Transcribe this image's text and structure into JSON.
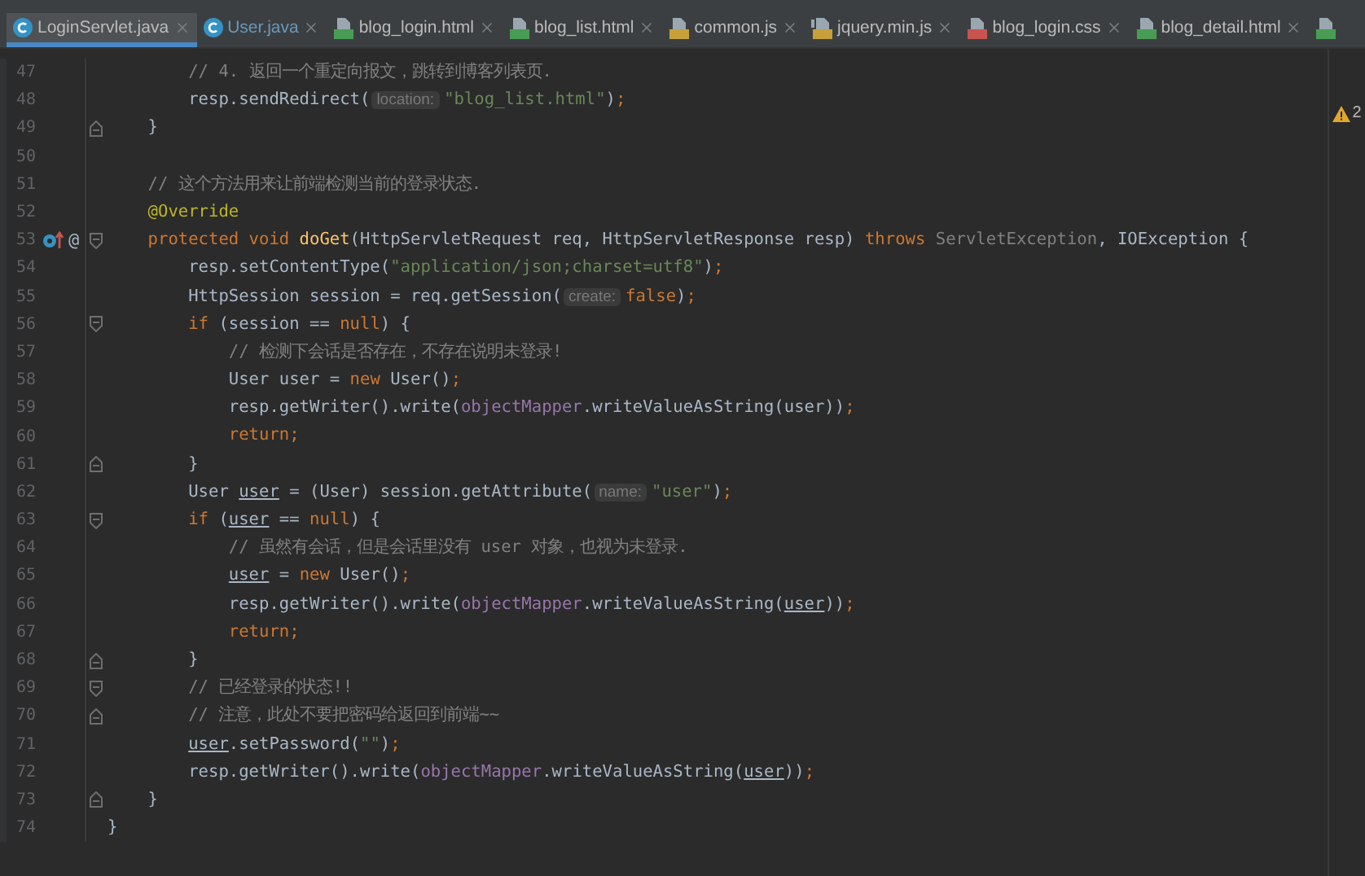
{
  "tabs": [
    {
      "kind": "java",
      "label": "LoginServlet.java",
      "selected": true,
      "modified": false
    },
    {
      "kind": "java",
      "label": "User.java",
      "selected": false,
      "modified": true
    },
    {
      "kind": "html",
      "label": "blog_login.html",
      "selected": false,
      "modified": false
    },
    {
      "kind": "html",
      "label": "blog_list.html",
      "selected": false,
      "modified": false
    },
    {
      "kind": "js",
      "label": "common.js",
      "selected": false,
      "modified": false
    },
    {
      "kind": "binary-js",
      "label": "jquery.min.js",
      "selected": false,
      "modified": false
    },
    {
      "kind": "css",
      "label": "blog_login.css",
      "selected": false,
      "modified": false
    },
    {
      "kind": "html",
      "label": "blog_detail.html",
      "selected": false,
      "modified": false
    },
    {
      "kind": "html",
      "selected": false
    }
  ],
  "inspections": {
    "warnings": "2"
  },
  "lines": [
    {
      "number": "47",
      "tokens": [
        {
          "text": "        // 4. 返回一个重定向报文，跳转到博客列表页.",
          "kind": "comment"
        }
      ]
    },
    {
      "number": "48",
      "tokens": [
        {
          "text": "        resp.sendRedirect(",
          "kind": "plain"
        },
        {
          "text": "location:",
          "kind": "hint"
        },
        {
          "text": "\"blog_list.html\"",
          "kind": "string"
        },
        {
          "text": ")",
          "kind": "plain"
        },
        {
          "text": ";",
          "kind": "keyword"
        }
      ]
    },
    {
      "number": "49",
      "fold_end": true,
      "tokens": [
        {
          "text": "    }",
          "kind": "plain"
        }
      ]
    },
    {
      "number": "50"
    },
    {
      "number": "51",
      "tokens": [
        {
          "text": "    // 这个方法用来让前端检测当前的登录状态.",
          "kind": "comment"
        }
      ]
    },
    {
      "number": "52",
      "tokens": [
        {
          "text": "    @Override",
          "kind": "annotation"
        }
      ]
    },
    {
      "number": "53",
      "fold_start": true,
      "gutter": [
        {
          "kind": "override"
        },
        {
          "kind": "symbol",
          "text": "@"
        }
      ],
      "tokens": [
        {
          "text": "    protected void ",
          "kind": "keyword"
        },
        {
          "text": "doGet",
          "kind": "function"
        },
        {
          "text": "(HttpServletRequest req, HttpServletResponse resp) ",
          "kind": "plain"
        },
        {
          "text": "throws ",
          "kind": "keyword"
        },
        {
          "text": "ServletException",
          "kind": "muted"
        },
        {
          "text": ", IOException {",
          "kind": "plain"
        }
      ]
    },
    {
      "number": "54",
      "tokens": [
        {
          "text": "        resp.setContentType(",
          "kind": "plain"
        },
        {
          "text": "\"application/json;charset=utf8\"",
          "kind": "string"
        },
        {
          "text": ")",
          "kind": "plain"
        },
        {
          "text": ";",
          "kind": "keyword"
        }
      ]
    },
    {
      "number": "55",
      "tokens": [
        {
          "text": "        HttpSession session = req.getSession(",
          "kind": "plain"
        },
        {
          "text": "create:",
          "kind": "hint"
        },
        {
          "text": "false",
          "kind": "keyword"
        },
        {
          "text": ")",
          "kind": "plain"
        },
        {
          "text": ";",
          "kind": "keyword"
        }
      ]
    },
    {
      "number": "56",
      "fold_start": true,
      "tokens": [
        {
          "text": "        if",
          "kind": "keyword"
        },
        {
          "text": " (session == ",
          "kind": "plain"
        },
        {
          "text": "null",
          "kind": "keyword"
        },
        {
          "text": ") {",
          "kind": "plain"
        }
      ]
    },
    {
      "number": "57",
      "tokens": [
        {
          "text": "            // 检测下会话是否存在，不存在说明未登录!",
          "kind": "comment"
        }
      ]
    },
    {
      "number": "58",
      "tokens": [
        {
          "text": "            User user = ",
          "kind": "plain"
        },
        {
          "text": "new",
          "kind": "keyword"
        },
        {
          "text": " User()",
          "kind": "plain"
        },
        {
          "text": ";",
          "kind": "keyword"
        }
      ]
    },
    {
      "number": "59",
      "tokens": [
        {
          "text": "            resp.getWriter().write(",
          "kind": "plain"
        },
        {
          "text": "objectMapper",
          "kind": "field"
        },
        {
          "text": ".writeValueAsString(user))",
          "kind": "plain"
        },
        {
          "text": ";",
          "kind": "keyword"
        }
      ]
    },
    {
      "number": "60",
      "tokens": [
        {
          "text": "            return;",
          "kind": "keyword"
        }
      ]
    },
    {
      "number": "61",
      "fold_end": true,
      "tokens": [
        {
          "text": "        }",
          "kind": "plain"
        }
      ]
    },
    {
      "number": "62",
      "tokens": [
        {
          "text": "        User ",
          "kind": "plain"
        },
        {
          "text": "user",
          "kind": "variable"
        },
        {
          "text": " = (User) session.getAttribute(",
          "kind": "plain"
        },
        {
          "text": "name:",
          "kind": "hint"
        },
        {
          "text": "\"user\"",
          "kind": "string"
        },
        {
          "text": ")",
          "kind": "plain"
        },
        {
          "text": ";",
          "kind": "keyword"
        }
      ]
    },
    {
      "number": "63",
      "fold_start": true,
      "tokens": [
        {
          "text": "        if",
          "kind": "keyword"
        },
        {
          "text": " (",
          "kind": "plain"
        },
        {
          "text": "user",
          "kind": "variable"
        },
        {
          "text": " == ",
          "kind": "plain"
        },
        {
          "text": "null",
          "kind": "keyword"
        },
        {
          "text": ") {",
          "kind": "plain"
        }
      ]
    },
    {
      "number": "64",
      "tokens": [
        {
          "text": "            // 虽然有会话，但是会话里没有 user 对象，也视为未登录.",
          "kind": "comment"
        }
      ]
    },
    {
      "number": "65",
      "tokens": [
        {
          "text": "            user",
          "kind": "variable"
        },
        {
          "text": " = ",
          "kind": "plain"
        },
        {
          "text": "new",
          "kind": "keyword"
        },
        {
          "text": " User()",
          "kind": "plain"
        },
        {
          "text": ";",
          "kind": "keyword"
        }
      ]
    },
    {
      "number": "66",
      "tokens": [
        {
          "text": "            resp.getWriter().write(",
          "kind": "plain"
        },
        {
          "text": "objectMapper",
          "kind": "field"
        },
        {
          "text": ".writeValueAsString(",
          "kind": "plain"
        },
        {
          "text": "user",
          "kind": "variable"
        },
        {
          "text": "))",
          "kind": "plain"
        },
        {
          "text": ";",
          "kind": "keyword"
        }
      ]
    },
    {
      "number": "67",
      "tokens": [
        {
          "text": "            return;",
          "kind": "keyword"
        }
      ]
    },
    {
      "number": "68",
      "fold_end": true,
      "tokens": [
        {
          "text": "        }",
          "kind": "plain"
        }
      ]
    },
    {
      "number": "69",
      "fold_start": true,
      "tokens": [
        {
          "text": "        // 已经登录的状态!!",
          "kind": "comment"
        }
      ]
    },
    {
      "number": "70",
      "fold_end": true,
      "tokens": [
        {
          "text": "        // 注意，此处不要把密码给返回到前端~~",
          "kind": "comment"
        }
      ]
    },
    {
      "number": "71",
      "tokens": [
        {
          "text": "        user",
          "kind": "variable"
        },
        {
          "text": ".setPassword(",
          "kind": "plain"
        },
        {
          "text": "\"\"",
          "kind": "string"
        },
        {
          "text": ")",
          "kind": "plain"
        },
        {
          "text": ";",
          "kind": "keyword"
        }
      ]
    },
    {
      "number": "72",
      "tokens": [
        {
          "text": "        resp.getWriter().write(",
          "kind": "plain"
        },
        {
          "text": "objectMapper",
          "kind": "field"
        },
        {
          "text": ".writeValueAsString(",
          "kind": "plain"
        },
        {
          "text": "user",
          "kind": "variable"
        },
        {
          "text": "))",
          "kind": "plain"
        },
        {
          "text": ";",
          "kind": "keyword"
        }
      ]
    },
    {
      "number": "73",
      "fold_end": true,
      "tokens": [
        {
          "text": "    }",
          "kind": "plain"
        }
      ]
    },
    {
      "number": "74",
      "tokens": [
        {
          "text": "}",
          "kind": "plain"
        }
      ]
    }
  ]
}
